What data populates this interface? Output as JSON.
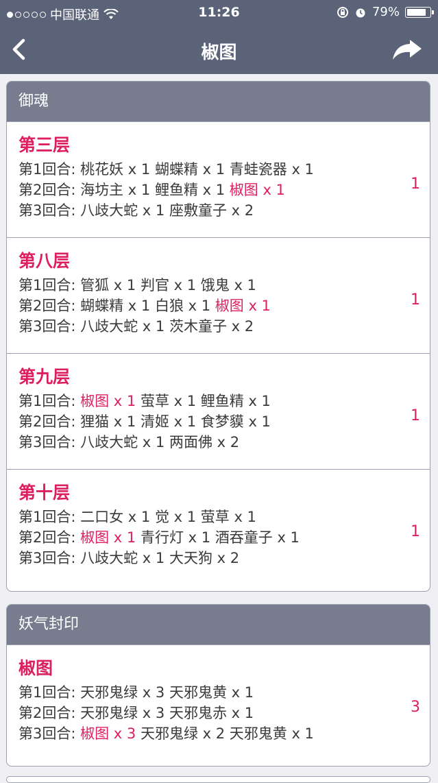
{
  "status_bar": {
    "carrier": "中国联通",
    "time": "11:26",
    "battery": "79%",
    "battery_level": 0.79
  },
  "nav": {
    "title": "椒图",
    "back_icon": "chevron-left-icon",
    "share_icon": "share-icon"
  },
  "sections": [
    {
      "title": "御魂",
      "entries": [
        {
          "layer": "第三层",
          "count": "1",
          "rounds": [
            {
              "label": "第1回合:",
              "segments": [
                {
                  "text": "桃花妖 x 1",
                  "hl": false
                },
                {
                  "text": "蝴蝶精 x 1",
                  "hl": false
                },
                {
                  "text": "青蛙瓷器 x 1",
                  "hl": false
                }
              ]
            },
            {
              "label": "第2回合:",
              "segments": [
                {
                  "text": "海坊主 x 1",
                  "hl": false
                },
                {
                  "text": "鲤鱼精 x 1",
                  "hl": false
                },
                {
                  "text": "椒图 x 1",
                  "hl": true
                }
              ]
            },
            {
              "label": "第3回合:",
              "segments": [
                {
                  "text": "八歧大蛇 x 1",
                  "hl": false
                },
                {
                  "text": "座敷童子 x 2",
                  "hl": false
                }
              ]
            }
          ]
        },
        {
          "layer": "第八层",
          "count": "1",
          "rounds": [
            {
              "label": "第1回合:",
              "segments": [
                {
                  "text": "管狐 x 1",
                  "hl": false
                },
                {
                  "text": "判官 x 1",
                  "hl": false
                },
                {
                  "text": "饿鬼 x 1",
                  "hl": false
                }
              ]
            },
            {
              "label": "第2回合:",
              "segments": [
                {
                  "text": "蝴蝶精 x 1",
                  "hl": false
                },
                {
                  "text": "白狼 x 1",
                  "hl": false
                },
                {
                  "text": "椒图 x 1",
                  "hl": true
                }
              ]
            },
            {
              "label": "第3回合:",
              "segments": [
                {
                  "text": "八歧大蛇 x 1",
                  "hl": false
                },
                {
                  "text": "茨木童子 x 2",
                  "hl": false
                }
              ]
            }
          ]
        },
        {
          "layer": "第九层",
          "count": "1",
          "rounds": [
            {
              "label": "第1回合:",
              "segments": [
                {
                  "text": "椒图 x 1",
                  "hl": true
                },
                {
                  "text": "萤草 x 1",
                  "hl": false
                },
                {
                  "text": "鲤鱼精 x 1",
                  "hl": false
                }
              ]
            },
            {
              "label": "第2回合:",
              "segments": [
                {
                  "text": "狸猫 x 1",
                  "hl": false
                },
                {
                  "text": "清姬 x 1",
                  "hl": false
                },
                {
                  "text": "食梦貘 x 1",
                  "hl": false
                }
              ]
            },
            {
              "label": "第3回合:",
              "segments": [
                {
                  "text": "八歧大蛇 x 1",
                  "hl": false
                },
                {
                  "text": "两面佛 x 2",
                  "hl": false
                }
              ]
            }
          ]
        },
        {
          "layer": "第十层",
          "count": "1",
          "rounds": [
            {
              "label": "第1回合:",
              "segments": [
                {
                  "text": "二口女 x 1",
                  "hl": false
                },
                {
                  "text": "觉 x 1",
                  "hl": false
                },
                {
                  "text": "萤草 x 1",
                  "hl": false
                }
              ]
            },
            {
              "label": "第2回合:",
              "segments": [
                {
                  "text": "椒图 x 1",
                  "hl": true
                },
                {
                  "text": "青行灯 x 1",
                  "hl": false
                },
                {
                  "text": "酒吞童子 x 1",
                  "hl": false
                }
              ]
            },
            {
              "label": "第3回合:",
              "segments": [
                {
                  "text": "八歧大蛇 x 1",
                  "hl": false
                },
                {
                  "text": "大天狗 x 2",
                  "hl": false
                }
              ]
            }
          ]
        }
      ]
    },
    {
      "title": "妖气封印",
      "entries": [
        {
          "layer": "椒图",
          "count": "3",
          "rounds": [
            {
              "label": "第1回合:",
              "segments": [
                {
                  "text": "天邪鬼绿 x 3",
                  "hl": false
                },
                {
                  "text": "天邪鬼黄 x 1",
                  "hl": false
                }
              ]
            },
            {
              "label": "第2回合:",
              "segments": [
                {
                  "text": "天邪鬼绿 x 3",
                  "hl": false
                },
                {
                  "text": "天邪鬼赤 x 1",
                  "hl": false
                }
              ]
            },
            {
              "label": "第3回合:",
              "segments": [
                {
                  "text": "椒图 x 3",
                  "hl": true
                },
                {
                  "text": "天邪鬼绿 x 2",
                  "hl": false
                },
                {
                  "text": "天邪鬼黄 x 1",
                  "hl": false
                }
              ]
            }
          ]
        }
      ]
    }
  ]
}
